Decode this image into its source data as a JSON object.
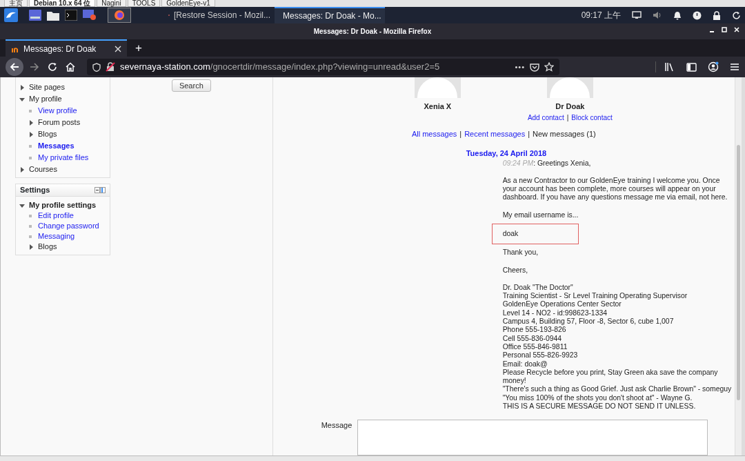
{
  "host_tabs": [
    {
      "label": "主页",
      "selected": false
    },
    {
      "label": "Debian 10.x 64 位",
      "selected": true
    },
    {
      "label": "Nagini",
      "selected": false
    },
    {
      "label": "TOOLS",
      "selected": false
    },
    {
      "label": "GoldenEye-v1",
      "selected": false
    }
  ],
  "taskbar": {
    "tasks": [
      {
        "label": "[Restore Session - Mozil...",
        "selected": false
      },
      {
        "label": "Messages: Dr Doak - Mo...",
        "selected": true
      }
    ],
    "clock": "09:17 上午"
  },
  "window": {
    "title": "Messages: Dr Doak - Mozilla Firefox"
  },
  "browser": {
    "tab": "Messages: Dr Doak",
    "new_tab": "+",
    "url_host": "severnaya-station.com",
    "url_path": "/gnocertdir/message/index.php?viewing=unread&user2=5",
    "page_actions": "•••"
  },
  "navigation": {
    "items": [
      {
        "label": "Site pages",
        "kind": "branch",
        "expanded": false,
        "bold": false
      },
      {
        "label": "My profile",
        "kind": "branch",
        "expanded": true,
        "bold": false,
        "children": [
          {
            "label": "View profile",
            "kind": "leaf",
            "bold": false
          },
          {
            "label": "Forum posts",
            "kind": "branch",
            "expanded": false,
            "bold": false
          },
          {
            "label": "Blogs",
            "kind": "branch",
            "expanded": false,
            "bold": false
          },
          {
            "label": "Messages",
            "kind": "leaf",
            "bold": true
          },
          {
            "label": "My private files",
            "kind": "leaf",
            "bold": false
          }
        ]
      },
      {
        "label": "Courses",
        "kind": "branch",
        "expanded": false,
        "bold": false
      }
    ]
  },
  "settings": {
    "title": "Settings",
    "items": [
      {
        "label": "My profile settings",
        "kind": "branch",
        "expanded": true,
        "bold": true,
        "children": [
          {
            "label": "Edit profile",
            "kind": "leaf",
            "bold": false
          },
          {
            "label": "Change password",
            "kind": "leaf",
            "bold": false
          },
          {
            "label": "Messaging",
            "kind": "leaf",
            "bold": false
          },
          {
            "label": "Blogs",
            "kind": "branch",
            "expanded": false,
            "bold": false
          }
        ]
      }
    ]
  },
  "search_button": "Search",
  "contacts": [
    {
      "name": "Xenia X"
    },
    {
      "name": "Dr Doak",
      "links": [
        "Add contact",
        "Block contact"
      ],
      "separator": "|"
    }
  ],
  "message_nav": {
    "items": [
      {
        "label": "All messages",
        "selected": false
      },
      {
        "label": "Recent messages",
        "selected": false
      },
      {
        "label": "New messages (1)",
        "selected": true
      }
    ],
    "separators": [
      "|",
      "|"
    ]
  },
  "date": "Tuesday, 24 April 2018",
  "message": {
    "time": "09:24 PM",
    "greeting": ": Greetings Xenia,",
    "paragraphs": [
      {
        "lines": [
          "As a new Contractor to our GoldenEye training I welcome you. Once your account has been complete, more courses will appear on your dashboard. If you have any questions message me via email, not here."
        ],
        "boxed": false
      },
      {
        "lines": [
          "My email username is..."
        ],
        "boxed": false
      },
      {
        "lines": [
          "doak"
        ],
        "boxed": true
      },
      {
        "lines": [
          "Thank you,"
        ],
        "boxed": false
      },
      {
        "lines": [
          "Cheers,"
        ],
        "boxed": false
      },
      {
        "lines": [
          "Dr. Doak \"The Doctor\"",
          "Training Scientist - Sr Level Training Operating Supervisor",
          "GoldenEye Operations Center Sector",
          "Level 14 - NO2 - id:998623-1334",
          "Campus 4, Building 57, Floor -8, Sector 6, cube 1,007",
          "Phone 555-193-826",
          "Cell 555-836-0944",
          "Office 555-846-9811",
          "Personal 555-826-9923",
          "Email: doak@",
          "Please Recycle before you print, Stay Green aka save the company money!",
          "\"There's such a thing as Good Grief. Just ask Charlie Brown\" - someguy",
          "\"You miss 100% of the shots you don't shoot at\" - Wayne G.",
          "THIS IS A SECURE MESSAGE DO NOT SEND IT UNLESS."
        ],
        "boxed": false
      }
    ]
  },
  "compose": {
    "label": "Message"
  }
}
